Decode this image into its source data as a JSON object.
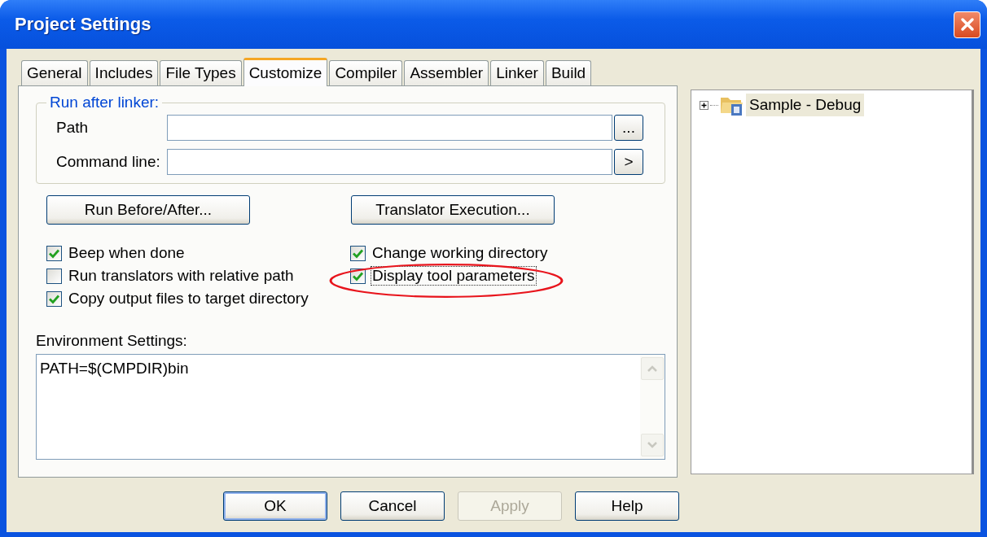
{
  "window": {
    "title": "Project Settings"
  },
  "tabs": [
    {
      "label": "General",
      "selected": false
    },
    {
      "label": "Includes",
      "selected": false
    },
    {
      "label": "File Types",
      "selected": false
    },
    {
      "label": "Customize",
      "selected": true
    },
    {
      "label": "Compiler",
      "selected": false
    },
    {
      "label": "Assembler",
      "selected": false
    },
    {
      "label": "Linker",
      "selected": false
    },
    {
      "label": "Build",
      "selected": false
    }
  ],
  "run_after_linker": {
    "title": "Run after linker:",
    "fields": [
      {
        "label": "Path",
        "button": "..."
      },
      {
        "label": "Command line:",
        "button": ">"
      }
    ]
  },
  "action_buttons": [
    "Run Before/After...",
    "Translator Execution..."
  ],
  "options_left": [
    {
      "label": "Beep when done",
      "checked": true,
      "circled": false,
      "focused": false
    },
    {
      "label": "Run translators with relative path",
      "checked": false,
      "circled": false,
      "focused": false
    },
    {
      "label": "Copy output files to target directory",
      "checked": true,
      "circled": false,
      "focused": false
    }
  ],
  "options_right": [
    {
      "label": "Change working directory",
      "checked": true,
      "circled": false,
      "focused": false
    },
    {
      "label": "Display tool parameters",
      "checked": true,
      "circled": true,
      "focused": true
    }
  ],
  "environment": {
    "label": "Environment Settings:",
    "value": "PATH=$(CMPDIR)bin"
  },
  "tree": [
    {
      "label": "Sample - Debug",
      "expanded": false,
      "selected": true
    }
  ],
  "buttons": [
    {
      "label": "OK",
      "default": true,
      "disabled": false
    },
    {
      "label": "Cancel",
      "default": false,
      "disabled": false
    },
    {
      "label": "Apply",
      "default": false,
      "disabled": true
    },
    {
      "label": "Help",
      "default": false,
      "disabled": false
    }
  ]
}
